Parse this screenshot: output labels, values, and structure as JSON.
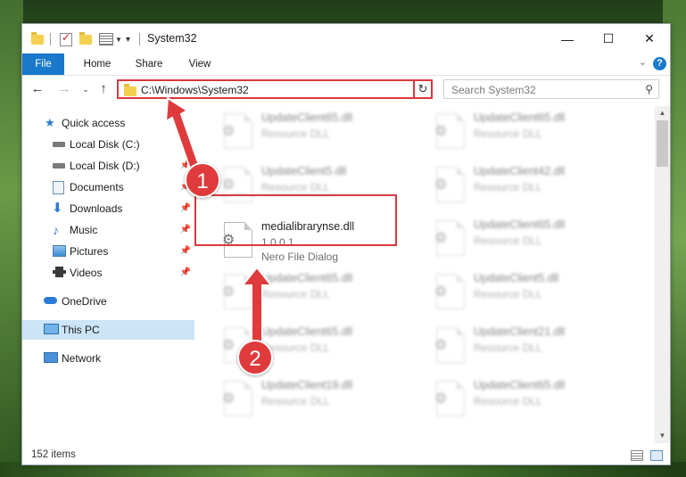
{
  "window": {
    "title": "System32",
    "controls": {
      "minimize": "—",
      "maximize": "☐",
      "close": "✕"
    }
  },
  "ribbon": {
    "tabs": [
      "File",
      "Home",
      "Share",
      "View"
    ],
    "help": "?"
  },
  "navbar": {
    "address": "C:\\Windows\\System32",
    "search_placeholder": "Search System32"
  },
  "nav_pane": {
    "items": [
      {
        "label": "Quick access",
        "icon": "star-icon"
      },
      {
        "label": "Local Disk (C:)",
        "icon": "drive-icon",
        "pinned": true
      },
      {
        "label": "Local Disk (D:)",
        "icon": "drive-icon",
        "pinned": true
      },
      {
        "label": "Documents",
        "icon": "documents-icon",
        "pinned": true
      },
      {
        "label": "Downloads",
        "icon": "download-icon",
        "pinned": true
      },
      {
        "label": "Music",
        "icon": "music-icon",
        "pinned": true
      },
      {
        "label": "Pictures",
        "icon": "pictures-icon",
        "pinned": true
      },
      {
        "label": "Videos",
        "icon": "videos-icon",
        "pinned": true
      },
      {
        "label": "OneDrive",
        "icon": "cloud-icon"
      },
      {
        "label": "This PC",
        "icon": "computer-icon",
        "selected": true
      },
      {
        "label": "Network",
        "icon": "network-icon"
      }
    ]
  },
  "files": {
    "left": [
      {
        "name": "UpdateClient65.dll",
        "desc": "Resource DLL"
      },
      {
        "name": "UpdateClient5.dll",
        "desc": "Resource DLL"
      },
      {
        "name": "medialibrarynse.dll",
        "version": "1.0.0.1",
        "desc": "Nero File Dialog",
        "highlighted": true
      },
      {
        "name": "UpdateClient65.dll",
        "desc": "Resource DLL"
      },
      {
        "name": "UpdateClient65.dll",
        "desc": "Resource DLL"
      },
      {
        "name": "UpdateClient19.dll",
        "desc": "Resource DLL"
      }
    ],
    "right": [
      {
        "name": "UpdateClient65.dll",
        "desc": "Resource DLL"
      },
      {
        "name": "UpdateClient42.dll",
        "desc": "Resource DLL"
      },
      {
        "name": "UpdateClient65.dll",
        "desc": "Resource DLL"
      },
      {
        "name": "UpdateClient5.dll",
        "desc": "Resource DLL"
      },
      {
        "name": "UpdateClient21.dll",
        "desc": "Resource DLL"
      },
      {
        "name": "UpdateClient65.dll",
        "desc": "Resource DLL"
      }
    ]
  },
  "status": {
    "count": "152 items"
  },
  "callouts": {
    "one": "1",
    "two": "2"
  },
  "colors": {
    "accent": "#1979ca",
    "highlight": "#d9383c",
    "selection": "#cce4f7"
  }
}
